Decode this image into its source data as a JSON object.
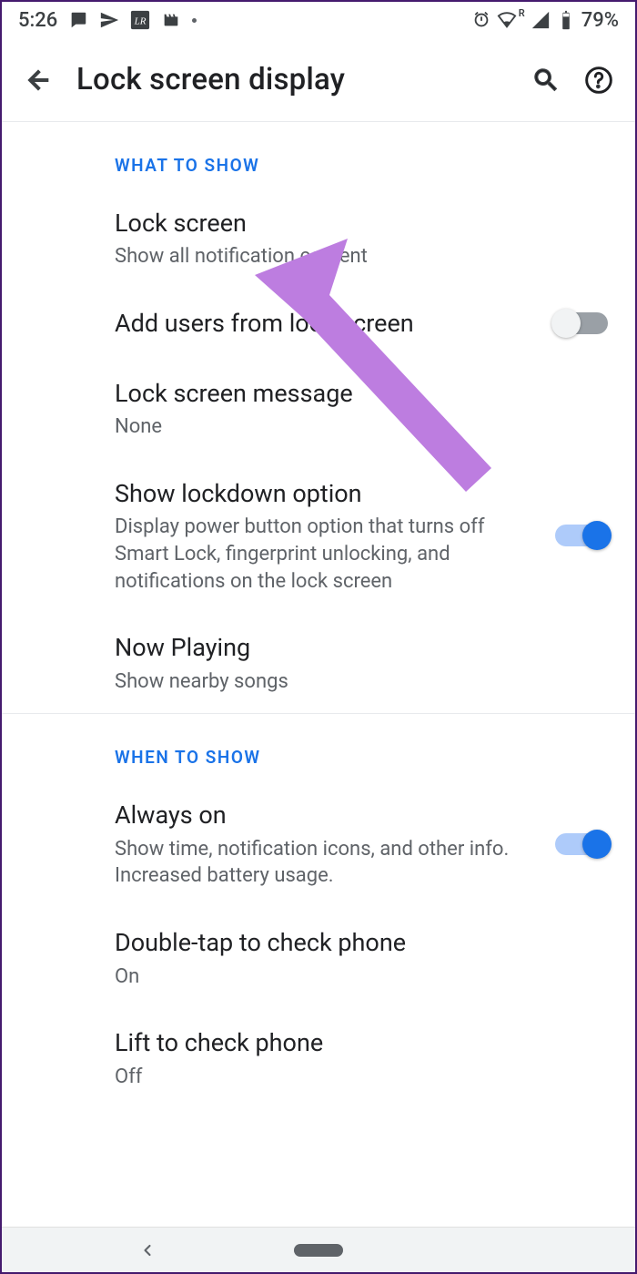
{
  "status": {
    "time": "5:26",
    "battery_pct": "79%"
  },
  "appbar": {
    "title": "Lock screen display"
  },
  "sections": {
    "what": {
      "header": "WHAT TO SHOW",
      "lock_screen": {
        "title": "Lock screen",
        "sub": "Show all notification content"
      },
      "add_users": {
        "title": "Add users from lock screen"
      },
      "message": {
        "title": "Lock screen message",
        "sub": "None"
      },
      "lockdown": {
        "title": "Show lockdown option",
        "sub": "Display power button option that turns off Smart Lock, fingerprint unlocking, and notifications on the lock screen"
      },
      "now_playing": {
        "title": "Now Playing",
        "sub": "Show nearby songs"
      }
    },
    "when": {
      "header": "WHEN TO SHOW",
      "always_on": {
        "title": "Always on",
        "sub": "Show time, notification icons, and other info. Increased battery usage."
      },
      "double_tap": {
        "title": "Double-tap to check phone",
        "sub": "On"
      },
      "lift": {
        "title": "Lift to check phone",
        "sub": "Off"
      }
    }
  },
  "toggles": {
    "add_users": false,
    "lockdown": true,
    "always_on": true
  }
}
